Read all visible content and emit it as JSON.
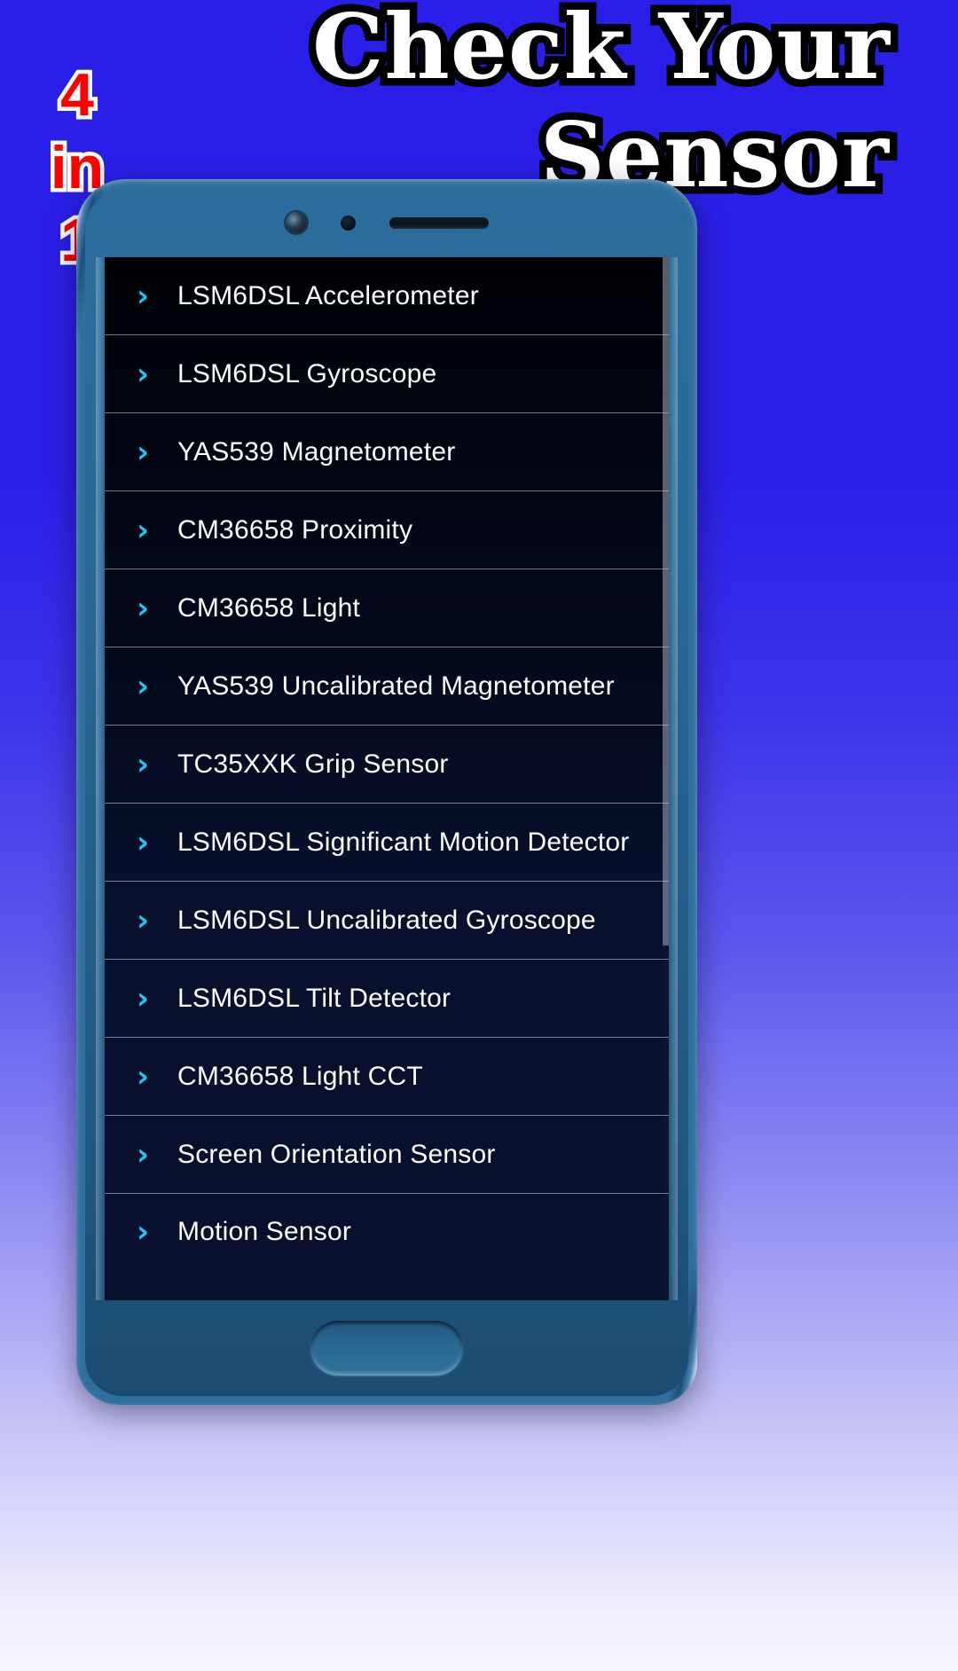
{
  "promo": {
    "title_lines": [
      "Check Your",
      "Sensor"
    ],
    "badge_lines": [
      "4",
      "in",
      "1"
    ],
    "title_color": "#ffffff",
    "title_outline_color": "#000000",
    "badge_color": "#ff0000",
    "badge_outline_color": "#ffffff",
    "background_top_color": "#2a1fe8",
    "background_bottom_color": "#f6f5ff"
  },
  "device": {
    "frame_color": "#2f6f9e",
    "screen_background": "#000106",
    "hardware": {
      "front_camera": "front-camera",
      "proximity_dot": "proximity-sensor",
      "earpiece": "earpiece-speaker",
      "home_button": "home-button"
    }
  },
  "app": {
    "accent_color": "#16c8f0",
    "text_color": "#ffffff",
    "divider_color": "#6f7277",
    "chevron_glyph": "›",
    "scroll_position_percent": 0,
    "sensors": [
      {
        "label": "LSM6DSL Accelerometer"
      },
      {
        "label": "LSM6DSL Gyroscope"
      },
      {
        "label": "YAS539 Magnetometer"
      },
      {
        "label": "CM36658 Proximity"
      },
      {
        "label": "CM36658 Light"
      },
      {
        "label": "YAS539 Uncalibrated Magnetometer"
      },
      {
        "label": "TC35XXK Grip Sensor"
      },
      {
        "label": "LSM6DSL Significant Motion Detector"
      },
      {
        "label": "LSM6DSL Uncalibrated Gyroscope"
      },
      {
        "label": "LSM6DSL Tilt Detector"
      },
      {
        "label": "CM36658 Light CCT"
      },
      {
        "label": "Screen Orientation Sensor"
      },
      {
        "label": "Motion Sensor"
      }
    ]
  }
}
